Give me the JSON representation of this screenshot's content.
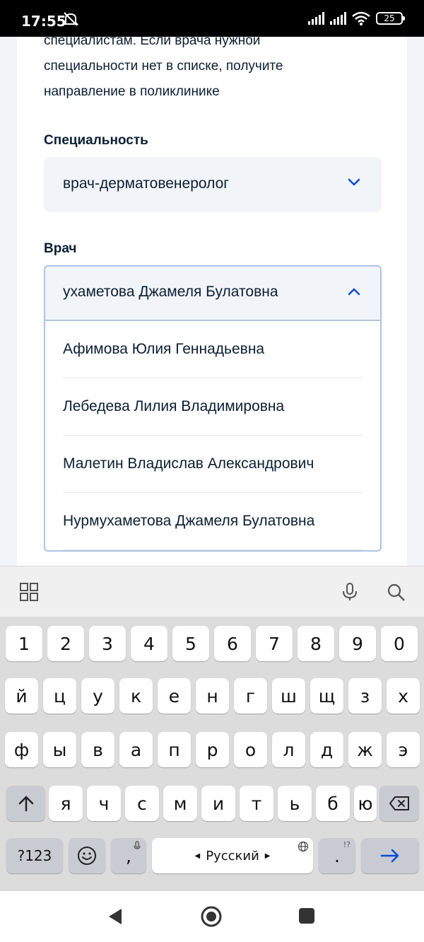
{
  "status_bar": {
    "time": "17:55",
    "battery": "25"
  },
  "intro": {
    "lines": [
      "специалистам. Если врача нужной",
      "специальности нет в списке, получите",
      "направление в поликлинике"
    ]
  },
  "specialty": {
    "label": "Специальность",
    "value": "врач-дерматовенеролог"
  },
  "doctor": {
    "label": "Врач",
    "value": "ухаметова Джамеля Булатовна",
    "options": [
      "Афимова Юлия Геннадьевна",
      "Лебедева Лилия Владимировна",
      "Малетин Владислав Александрович",
      "Нурмухаметова Джамеля Булатовна"
    ]
  },
  "keyboard": {
    "row_numbers": [
      "1",
      "2",
      "3",
      "4",
      "5",
      "6",
      "7",
      "8",
      "9",
      "0"
    ],
    "row1": [
      "й",
      "ц",
      "у",
      "к",
      "е",
      "н",
      "г",
      "ш",
      "щ",
      "з",
      "х"
    ],
    "row2": [
      "ф",
      "ы",
      "в",
      "а",
      "п",
      "р",
      "о",
      "л",
      "д",
      "ж",
      "э"
    ],
    "row3": [
      "я",
      "ч",
      "с",
      "м",
      "и",
      "т",
      "ь",
      "б",
      "ю"
    ],
    "symbols_label": "?123",
    "comma": ",",
    "space_label": "Русский",
    "period": ".",
    "period_sub": "!?"
  },
  "colors": {
    "accent": "#0d4cd3",
    "field_bg": "#f1f4f8",
    "focus_border": "#aec4e3"
  }
}
